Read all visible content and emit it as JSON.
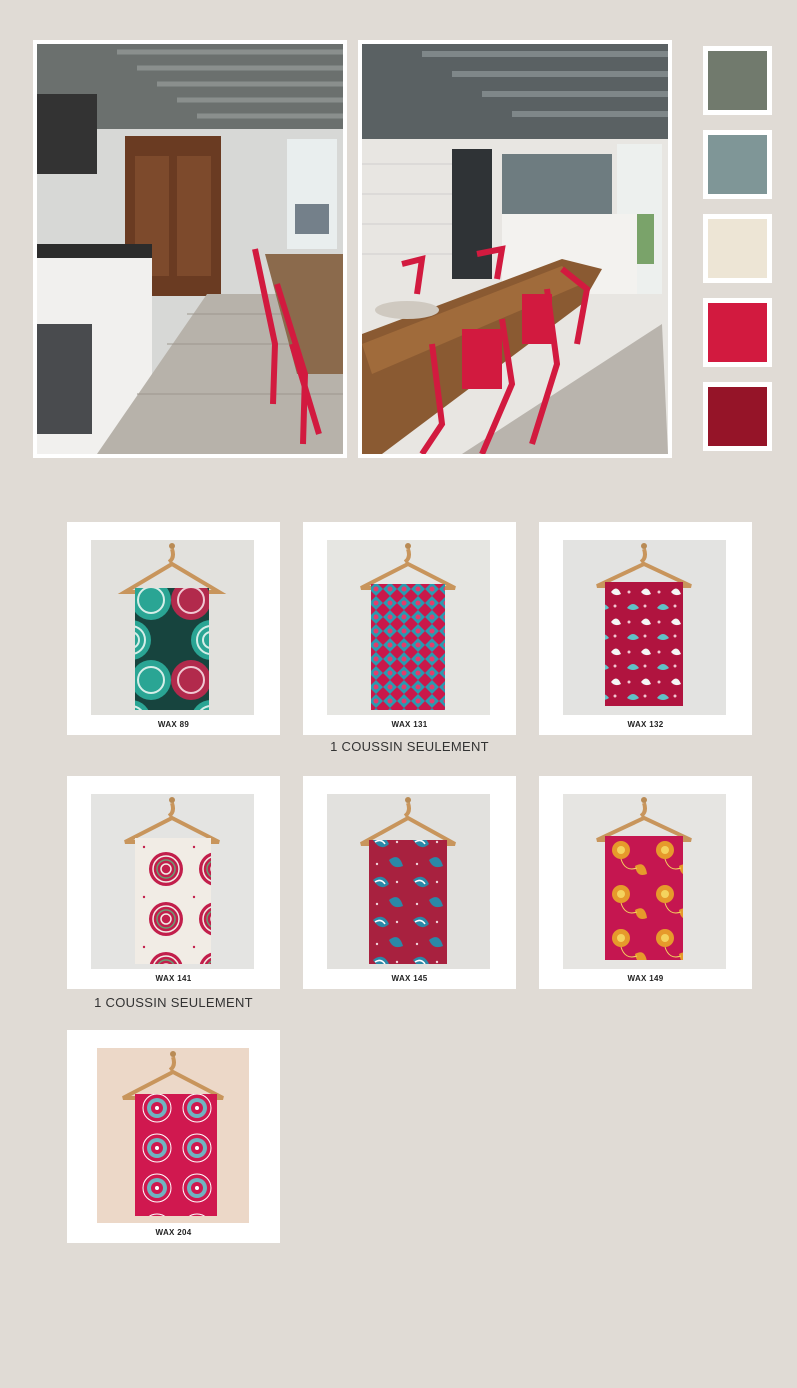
{
  "palette": [
    {
      "name": "sage",
      "color": "#717a6d"
    },
    {
      "name": "blue-grey",
      "color": "#7f9697"
    },
    {
      "name": "cream",
      "color": "#ede5d5"
    },
    {
      "name": "red",
      "color": "#d21a3f"
    },
    {
      "name": "burgundy",
      "color": "#951428"
    }
  ],
  "fabrics": [
    {
      "label": "WAX 89"
    },
    {
      "label": "WAX 131"
    },
    {
      "label": "WAX 132"
    },
    {
      "label": "WAX 141"
    },
    {
      "label": "WAX 145"
    },
    {
      "label": "WAX 149"
    },
    {
      "label": "WAX 204"
    }
  ],
  "notes": {
    "wax131": "1 COUSSIN SEULEMENT",
    "wax141": "1 COUSSIN SEULEMENT"
  }
}
